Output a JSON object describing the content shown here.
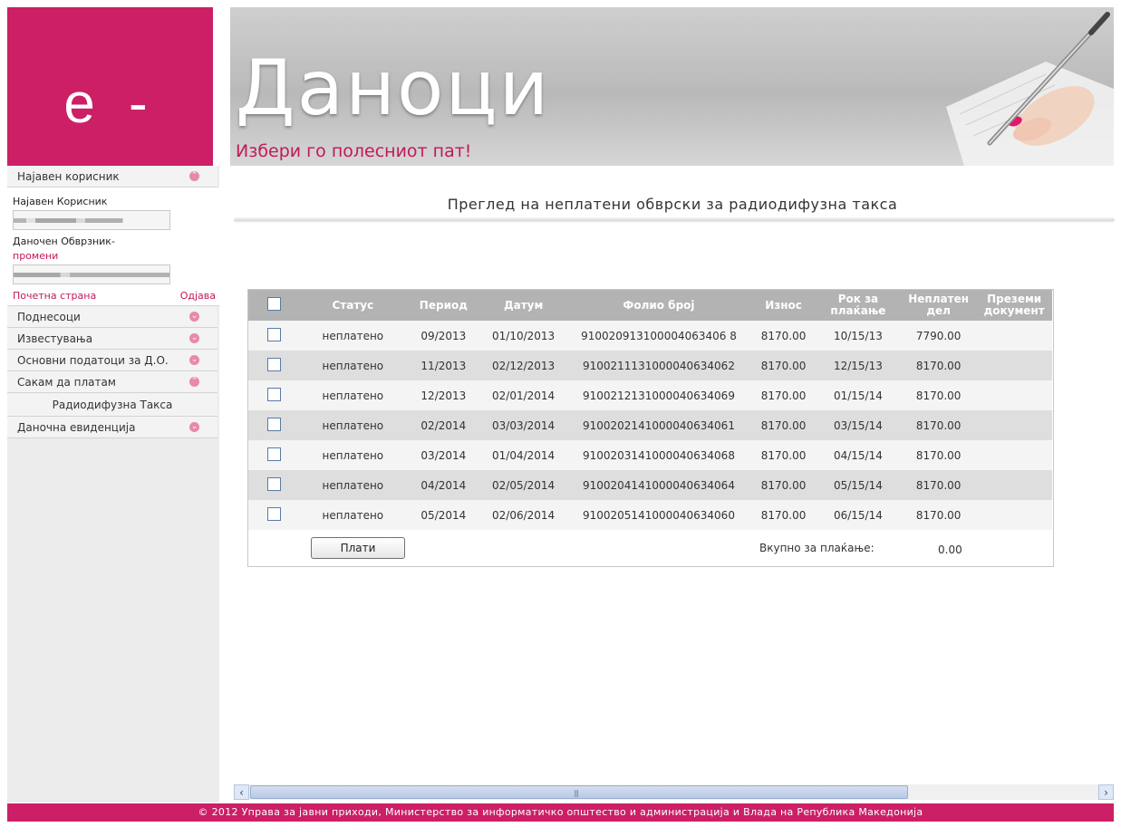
{
  "header": {
    "logo_text": "e -",
    "banner_title": "Даноци",
    "slogan": "Избери го полесниот пат!"
  },
  "sidebar": {
    "logged_user_item": "Најавен корисник",
    "user_panel": {
      "user_label": "Најавен Корисник",
      "taxpayer_label": "Даночен Обврзник-",
      "change_link": "промени",
      "home_link": "Почетна страна",
      "logout_link": "Одјава"
    },
    "items": [
      {
        "label": "Поднесоци"
      },
      {
        "label": "Известувања"
      },
      {
        "label": "Основни податоци за Д.О."
      },
      {
        "label": "Сакам да платам"
      }
    ],
    "sub_item": "Радиодифузна Такса",
    "last_item": "Даночна евиденција"
  },
  "main": {
    "heading": "Преглед на неплатени обврски за радиодифузна такса",
    "table": {
      "headers": [
        "Статус",
        "Период",
        "Датум",
        "Фолио број",
        "Износ",
        "Рок за плаќање",
        "Неплатен дел",
        "Преземи документ"
      ],
      "rows": [
        {
          "status": "неплатено",
          "period": "09/2013",
          "date": "01/10/2013",
          "folio": "910020913100004063406 8",
          "amount": "8170.00",
          "due": "10/15/13",
          "unpaid": "7790.00"
        },
        {
          "status": "неплатено",
          "period": "11/2013",
          "date": "02/12/2013",
          "folio": "9100211131000040634062",
          "amount": "8170.00",
          "due": "12/15/13",
          "unpaid": "8170.00"
        },
        {
          "status": "неплатено",
          "period": "12/2013",
          "date": "02/01/2014",
          "folio": "9100212131000040634069",
          "amount": "8170.00",
          "due": "01/15/14",
          "unpaid": "8170.00"
        },
        {
          "status": "неплатено",
          "period": "02/2014",
          "date": "03/03/2014",
          "folio": "9100202141000040634061",
          "amount": "8170.00",
          "due": "03/15/14",
          "unpaid": "8170.00"
        },
        {
          "status": "неплатено",
          "period": "03/2014",
          "date": "01/04/2014",
          "folio": "9100203141000040634068",
          "amount": "8170.00",
          "due": "04/15/14",
          "unpaid": "8170.00"
        },
        {
          "status": "неплатено",
          "period": "04/2014",
          "date": "02/05/2014",
          "folio": "9100204141000040634064",
          "amount": "8170.00",
          "due": "05/15/14",
          "unpaid": "8170.00"
        },
        {
          "status": "неплатено",
          "period": "05/2014",
          "date": "02/06/2014",
          "folio": "9100205141000040634060",
          "amount": "8170.00",
          "due": "06/15/14",
          "unpaid": "8170.00"
        }
      ]
    },
    "pay_button": "Плати",
    "total_label": "Вкупно за плаќање:",
    "total_value": "0.00"
  },
  "footer": {
    "copyright": "© 2012 Управа за јавни приходи, Министерство за информатичко општество и администрација и Влада на Република Македонија"
  },
  "colors": {
    "brand": "#cc1f66",
    "table_header": "#b3b3b3"
  }
}
